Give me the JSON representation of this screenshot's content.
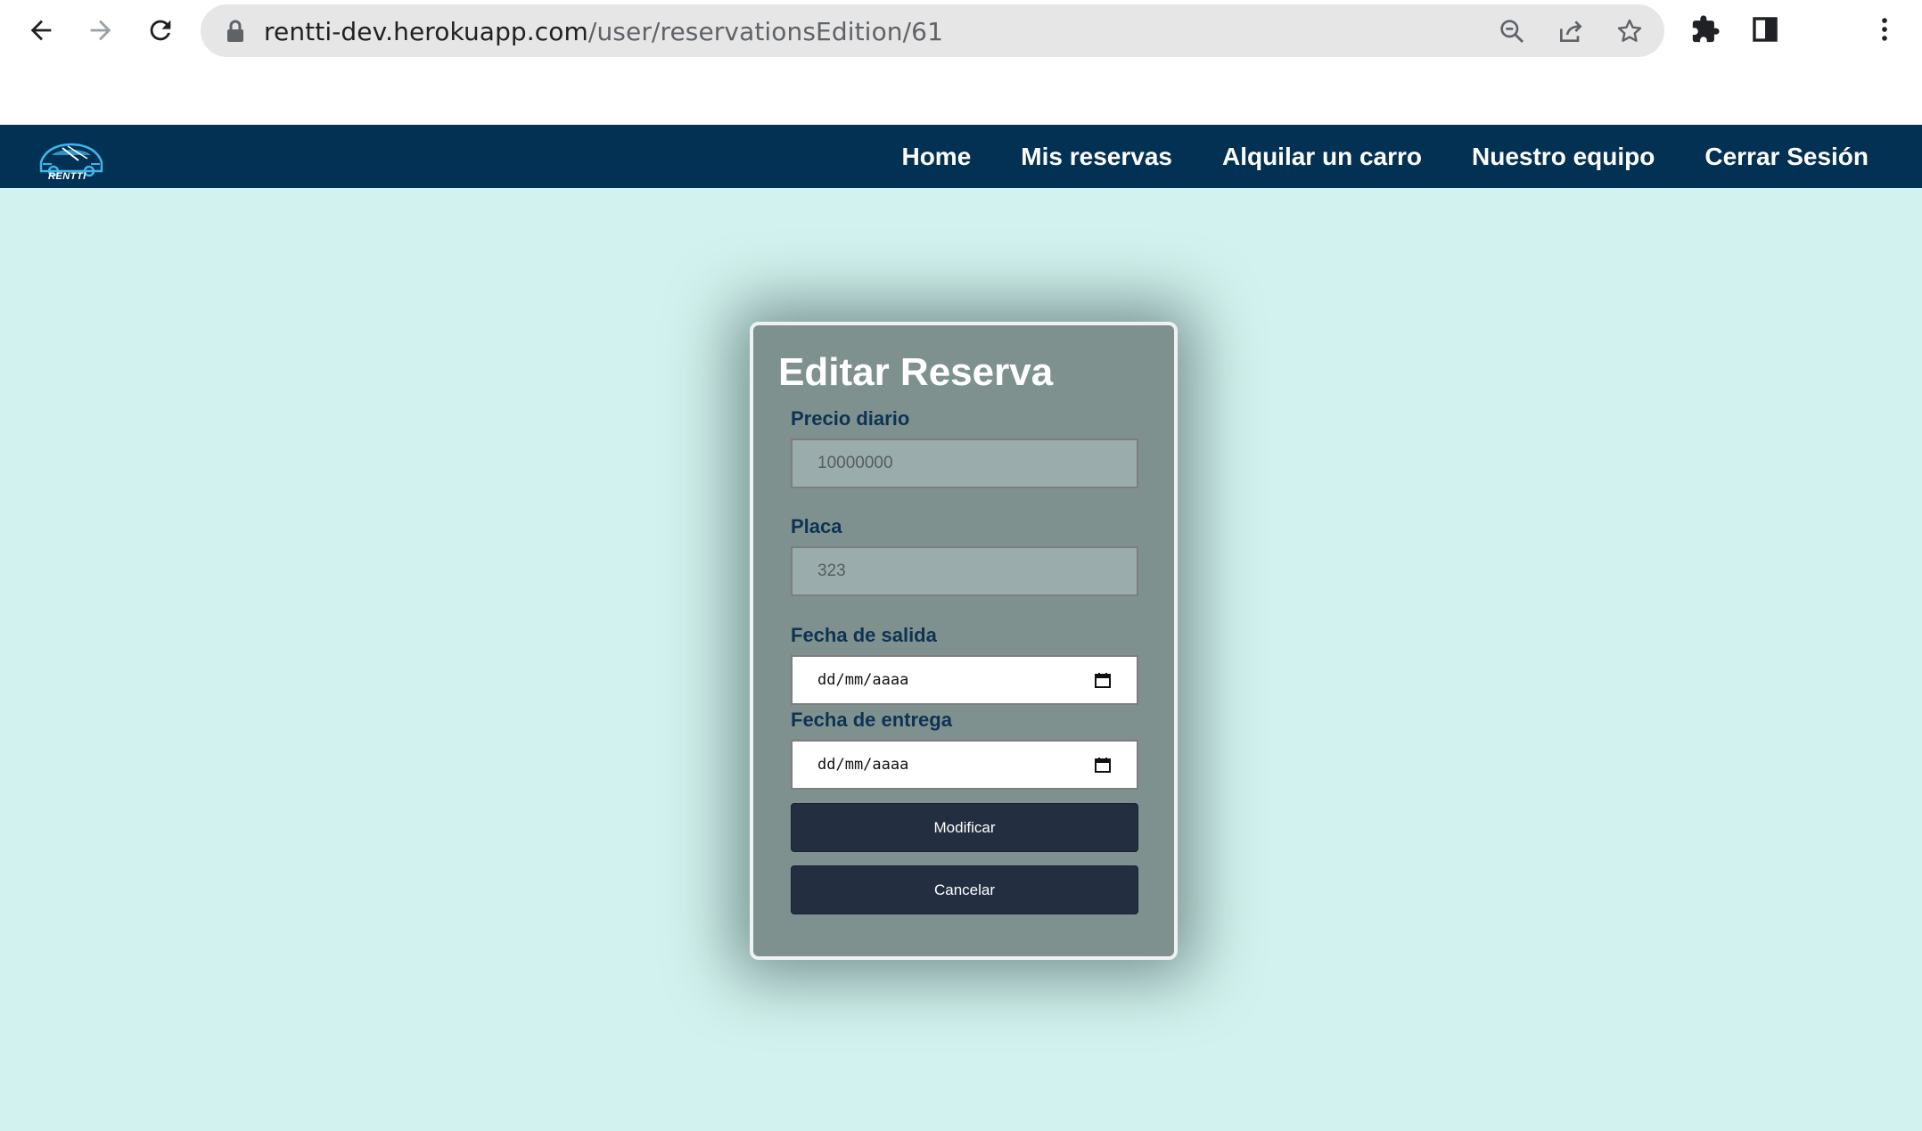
{
  "browser": {
    "url_host": "rentti-dev.herokuapp.com",
    "url_path": "/user/reservationsEdition/61",
    "icons": [
      "back-arrow-icon",
      "forward-arrow-icon",
      "reload-icon",
      "lock-icon",
      "zoom-out-icon",
      "share-icon",
      "star-icon",
      "extensions-icon",
      "side-panel-icon",
      "more-menu-icon"
    ]
  },
  "navbar": {
    "logo_text": "RENTTI",
    "links": [
      {
        "label": "Home"
      },
      {
        "label": "Mis reservas"
      },
      {
        "label": "Alquilar un carro"
      },
      {
        "label": "Nuestro equipo"
      },
      {
        "label": "Cerrar Sesión"
      }
    ]
  },
  "form": {
    "title": "Editar Reserva",
    "precio": {
      "label": "Precio diario",
      "value": "10000000"
    },
    "placa": {
      "label": "Placa",
      "value": "323"
    },
    "fecha_salida": {
      "label": "Fecha de salida",
      "placeholder": "dd/mm/aaaa"
    },
    "fecha_entrega": {
      "label": "Fecha de entrega",
      "placeholder": "dd/mm/aaaa"
    },
    "submit_label": "Modificar",
    "cancel_label": "Cancelar"
  },
  "colors": {
    "navbar": "#033154",
    "page_background": "#d1f2ee",
    "card": "#7f918f",
    "button": "#232f40",
    "label": "#0e3352"
  }
}
